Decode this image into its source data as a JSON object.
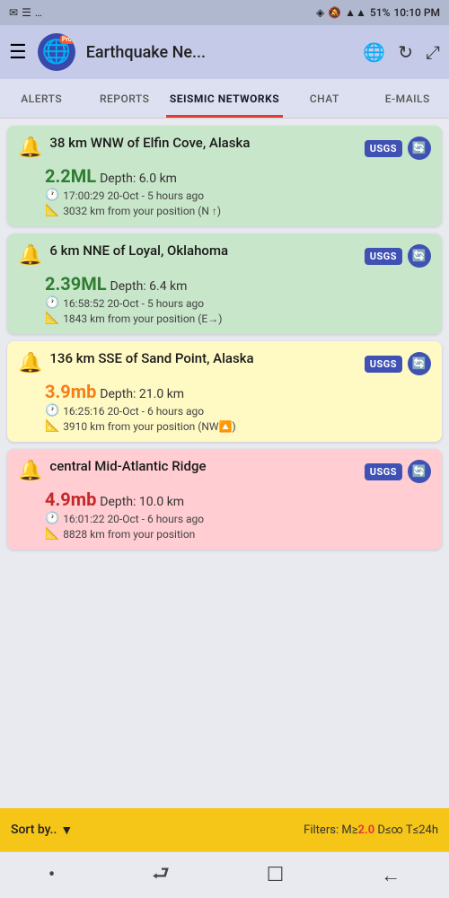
{
  "statusBar": {
    "leftIcons": [
      "✉",
      "☰",
      "…"
    ],
    "location": "◈",
    "silent": "🔕",
    "wifi": "WiFi",
    "signal": "▲▲▲",
    "battery": "51%",
    "time": "10:10 PM"
  },
  "header": {
    "menuIcon": "☰",
    "appName": "Earthquake Ne...",
    "globeIcon": "🌐",
    "refreshIcon": "↻",
    "expandIcon": "⤢",
    "proLabel": "Pro"
  },
  "tabs": [
    {
      "id": "alerts",
      "label": "ALERTS",
      "active": false
    },
    {
      "id": "reports",
      "label": "REPORTS",
      "active": false
    },
    {
      "id": "seismic",
      "label": "SEISMIC NETWORKS",
      "active": true
    },
    {
      "id": "chat",
      "label": "CHAT",
      "active": false
    },
    {
      "id": "emails",
      "label": "E-MAILS",
      "active": false
    }
  ],
  "earthquakes": [
    {
      "id": "eq1",
      "color": "green",
      "title": "38 km WNW of Elfin Cove, Alaska",
      "source": "USGS",
      "magnitude": "2.2ML",
      "depth": "Depth: 6.0 km",
      "time": "17:00:29 20-Oct - 5 hours ago",
      "distance": "3032 km from your position (N ↑)"
    },
    {
      "id": "eq2",
      "color": "green",
      "title": "6 km NNE of Loyal, Oklahoma",
      "source": "USGS",
      "magnitude": "2.39ML",
      "depth": "Depth: 6.4 km",
      "time": "16:58:52 20-Oct - 5 hours ago",
      "distance": "1843 km from your position (E→)"
    },
    {
      "id": "eq3",
      "color": "yellow",
      "title": "136 km SSE of Sand Point, Alaska",
      "source": "USGS",
      "magnitude": "3.9mb",
      "depth": "Depth: 21.0 km",
      "time": "16:25:16 20-Oct - 6 hours ago",
      "distance": "3910 km from your position (NW🔼)"
    },
    {
      "id": "eq4",
      "color": "pink",
      "title": "central Mid-Atlantic Ridge",
      "source": "USGS",
      "magnitude": "4.9mb",
      "depth": "Depth: 10.0 km",
      "time": "16:01:22 20-Oct - 6 hours ago",
      "distance": "8828 km from your position"
    }
  ],
  "bottomBar": {
    "sortLabel": "Sort by..",
    "dropdownIcon": "▼",
    "filterText": "Filters: M≥",
    "filterMag": "2.0",
    "filterDistance": " D≤∞ T≤24h"
  },
  "navBar": {
    "dotIcon": "•",
    "returnIcon": "⮐",
    "squareIcon": "☐",
    "backIcon": "←"
  }
}
